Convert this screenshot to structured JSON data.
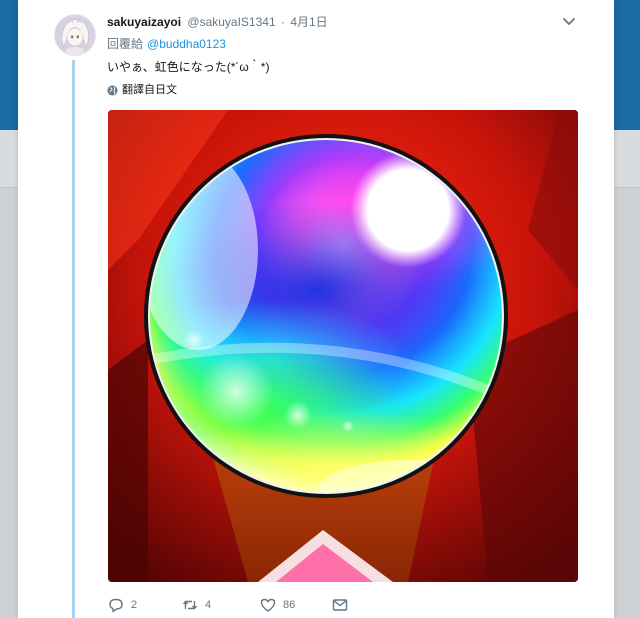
{
  "tweet": {
    "display_name": "sakuyaizayoi",
    "handle": "@sakuyaIS1341",
    "separator": "·",
    "date": "4月1日",
    "reply_prefix": "回覆給",
    "reply_mention": "@buddha0123",
    "text": "いやぁ、虹色になった(*´ω｀*)",
    "translate_label": "翻譯自日文"
  },
  "actions": {
    "reply_count": "2",
    "retweet_count": "4",
    "like_count": "86"
  },
  "icons": {
    "caret": "chevron-down-icon",
    "translate": "globe-icon",
    "reply": "reply-icon",
    "retweet": "retweet-icon",
    "like": "heart-icon",
    "dm": "envelope-icon"
  },
  "colors": {
    "accent": "#1b95e0",
    "thread_line": "#a8d3ef",
    "header_bg": "#1c6aa3",
    "muted_text": "#657786"
  }
}
